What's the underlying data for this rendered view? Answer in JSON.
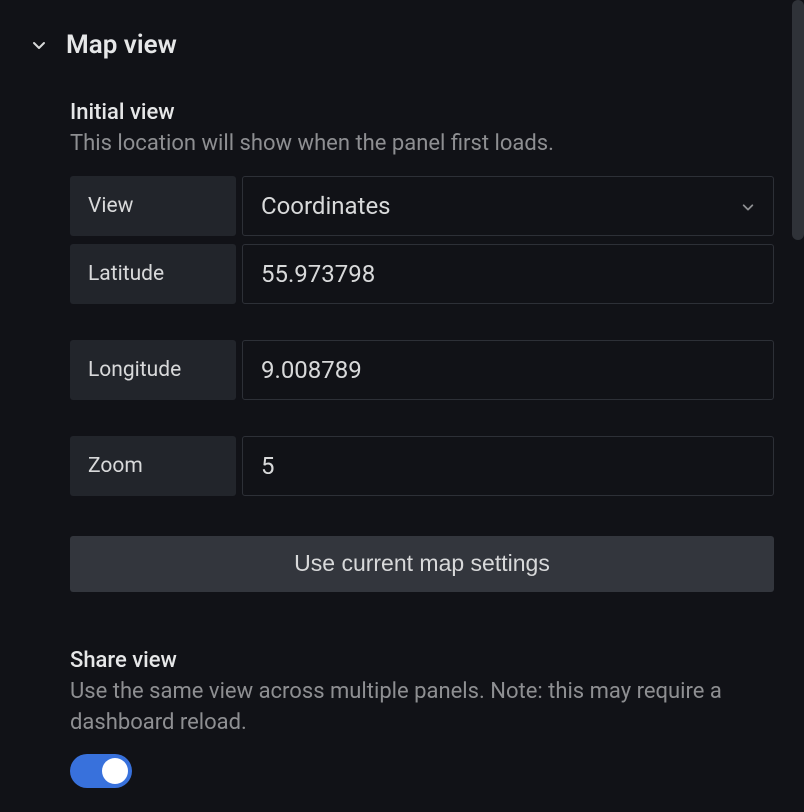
{
  "section": {
    "title": "Map view"
  },
  "initial_view": {
    "title": "Initial view",
    "description": "This location will show when the panel first loads.",
    "view_label": "View",
    "view_value": "Coordinates",
    "latitude_label": "Latitude",
    "latitude_value": "55.973798",
    "longitude_label": "Longitude",
    "longitude_value": "9.008789",
    "zoom_label": "Zoom",
    "zoom_value": "5",
    "use_current_button": "Use current map settings"
  },
  "share_view": {
    "title": "Share view",
    "description": "Use the same view across multiple panels. Note: this may require a dashboard reload.",
    "toggle_on": true
  }
}
